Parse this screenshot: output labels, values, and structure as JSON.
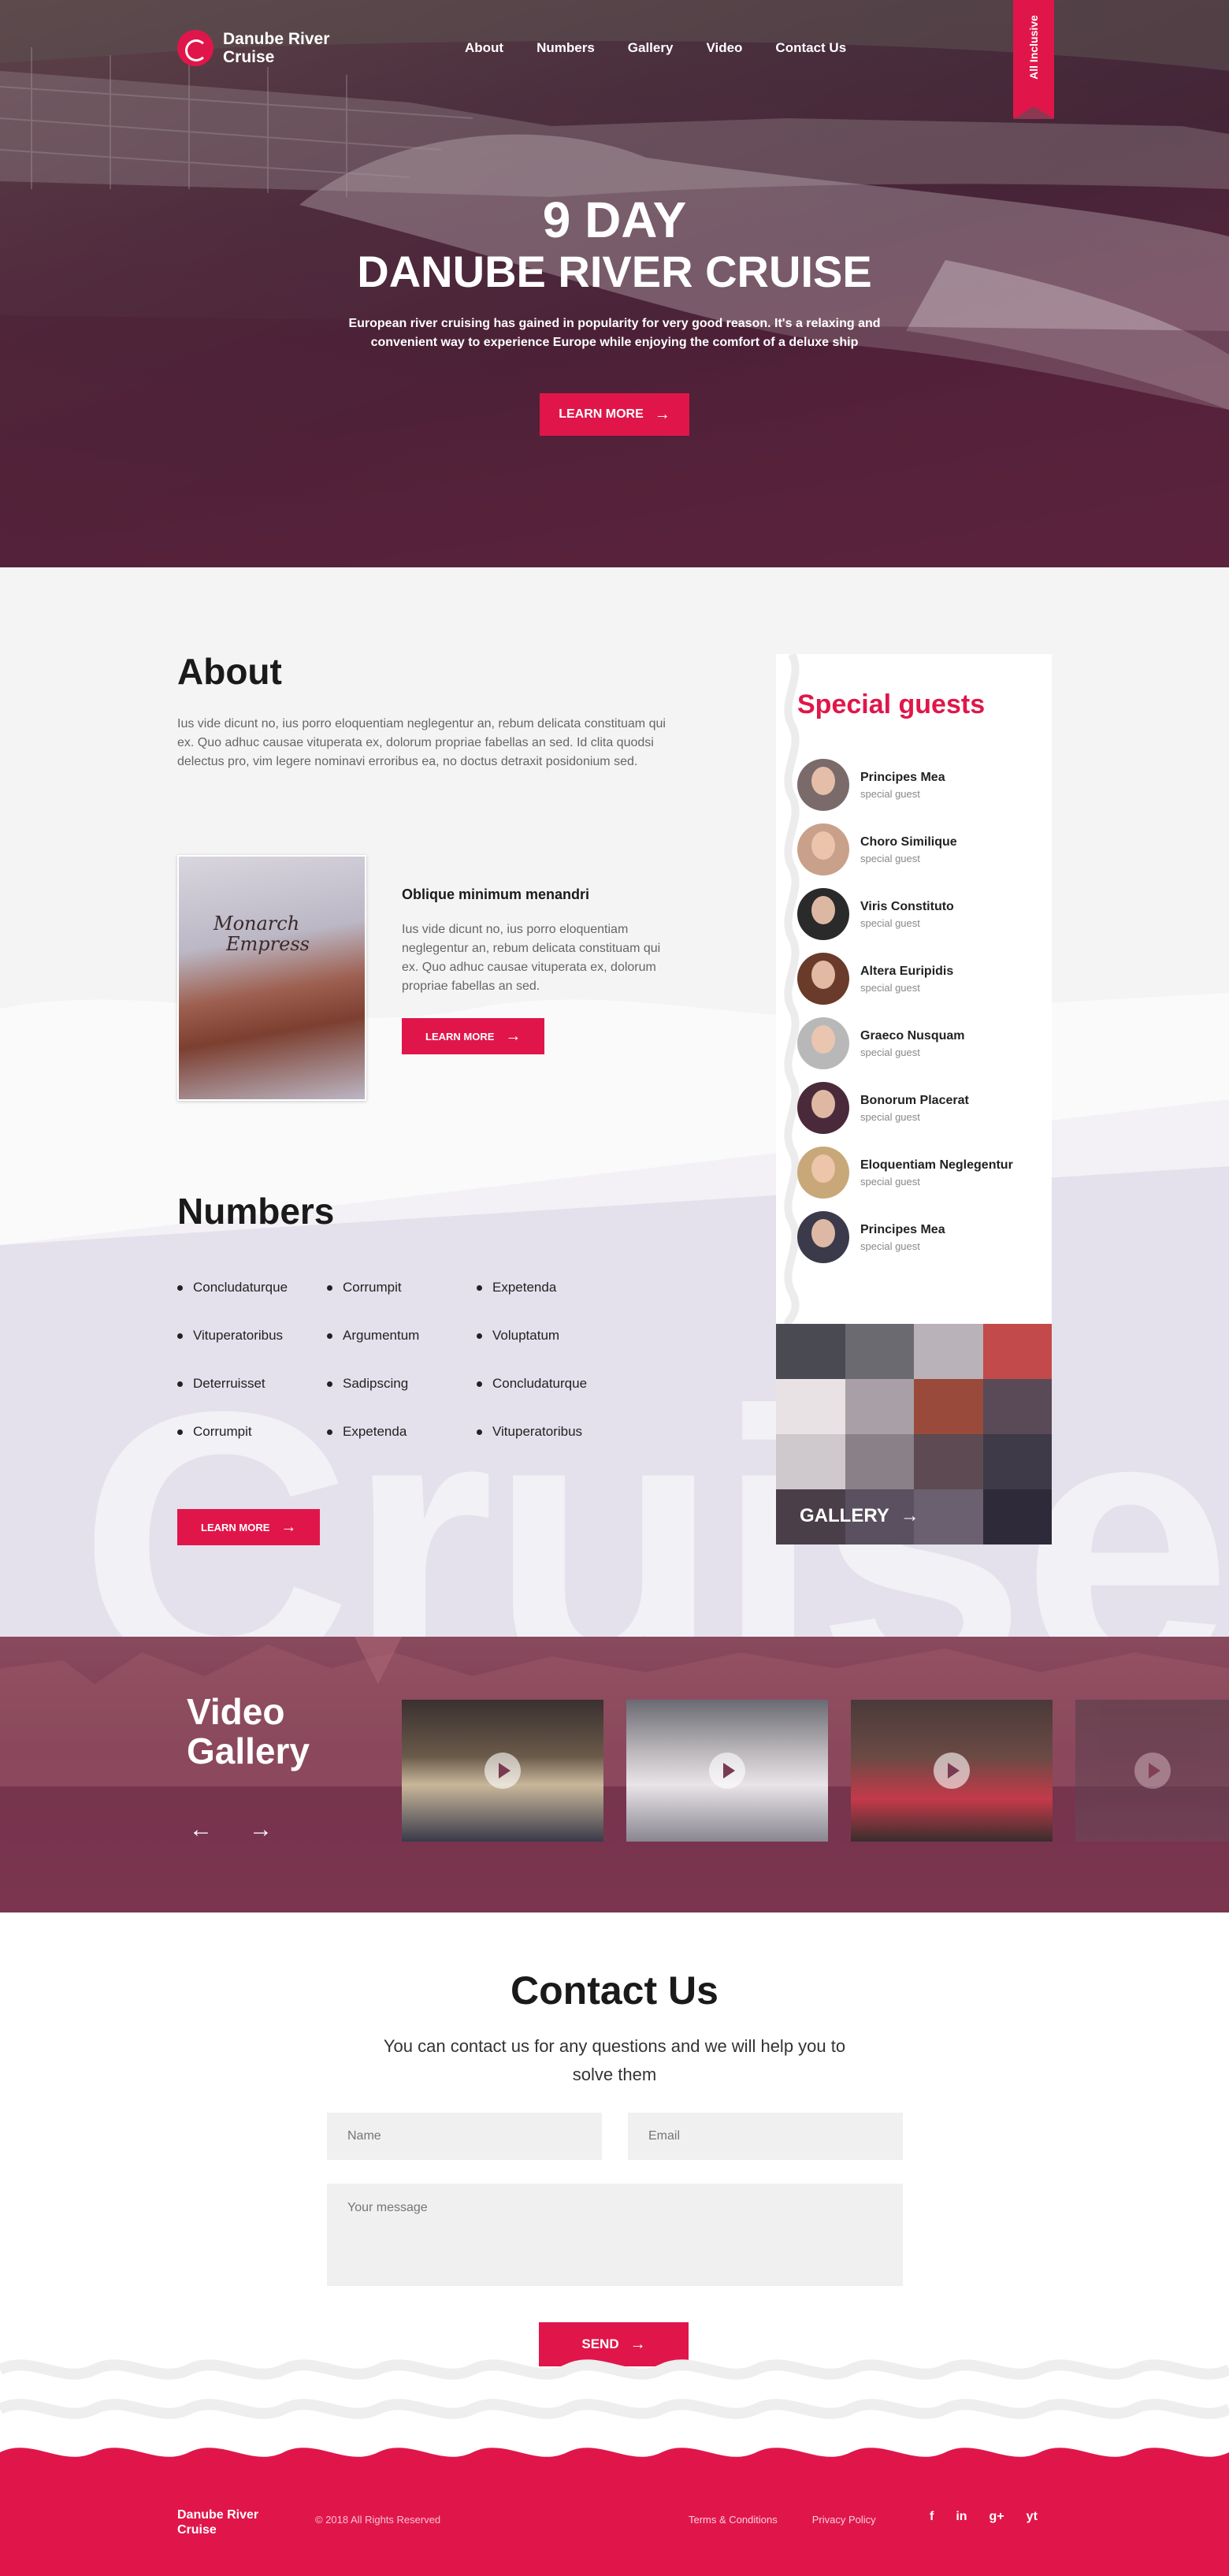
{
  "brand": {
    "name": "Danube River Cruise",
    "line1": "Danube River",
    "line2": "Cruise"
  },
  "nav": {
    "items": [
      {
        "label": "About"
      },
      {
        "label": "Numbers"
      },
      {
        "label": "Gallery"
      },
      {
        "label": "Video"
      },
      {
        "label": "Contact Us"
      }
    ]
  },
  "ribbon": "All Inclusive",
  "hero": {
    "line1": "9 DAY",
    "line2": "DANUBE RIVER CRUISE",
    "subtitle": "European river cruising has gained in popularity for very good reason. It's a relaxing and convenient way to experience Europe while enjoying the comfort of a deluxe ship",
    "button": "LEARN MORE"
  },
  "about": {
    "title": "About",
    "text": "Ius vide dicunt no, ius porro eloquentiam neglegentur an, rebum delicata constituam qui ex. Quo adhuc causae vituperata ex, dolorum propriae fabellas an sed. Id clita quodsi delectus pro, vim legere nominavi erroribus ea, no doctus detraxit posidonium sed.",
    "card": {
      "image_text_1": "Monarch",
      "image_text_2": "Empress",
      "title": "Oblique minimum menandri",
      "text": "Ius vide dicunt no, ius porro eloquentiam neglegentur an, rebum delicata constituam qui ex. Quo adhuc causae vituperata ex, dolorum propriae fabellas an sed.",
      "button": "LEARN MORE"
    }
  },
  "numbers": {
    "title": "Numbers",
    "items": [
      "Concludaturque",
      "Corrumpit",
      "Expetenda",
      "Vituperatoribus",
      "Argumentum",
      "Voluptatum",
      "Deterruisset",
      "Sadipscing",
      "Concludaturque",
      "Corrumpit",
      "Expetenda",
      "Vituperatoribus"
    ],
    "button": "LEARN MORE",
    "watermark": "Cruise"
  },
  "guests": {
    "title": "Special guests",
    "items": [
      {
        "name": "Principes Mea",
        "role": "special guest",
        "color": "#7a6a6a"
      },
      {
        "name": "Choro Similique",
        "role": "special guest",
        "color": "#c9a08a"
      },
      {
        "name": "Viris Constituto",
        "role": "special guest",
        "color": "#2a2a2a"
      },
      {
        "name": "Altera Euripidis",
        "role": "special guest",
        "color": "#6a3a2a"
      },
      {
        "name": "Graeco Nusquam",
        "role": "special guest",
        "color": "#b8b8b8"
      },
      {
        "name": "Bonorum Placerat",
        "role": "special guest",
        "color": "#4a2a3a"
      },
      {
        "name": "Eloquentiam Neglegentur",
        "role": "special guest",
        "color": "#c8a878"
      },
      {
        "name": "Principes Mea",
        "role": "special guest",
        "color": "#3a3a4a"
      }
    ]
  },
  "gallery": {
    "label": "GALLERY"
  },
  "video": {
    "title": "Video Gallery"
  },
  "contact": {
    "title": "Contact Us",
    "subtitle": "You can contact us for any questions and we will help you to solve them",
    "name_placeholder": "Name",
    "email_placeholder": "Email",
    "message_placeholder": "Your message",
    "button": "SEND"
  },
  "footer": {
    "line1": "Danube River",
    "line2": "Cruise",
    "copyright": "© 2018 All Rights Reserved",
    "links": [
      "Terms & Conditions",
      "Privacy Policy"
    ],
    "social": [
      "f",
      "in",
      "g+",
      "yt"
    ]
  },
  "colors": {
    "accent": "#e0164a",
    "hero_overlay": "#5a2c40",
    "numbers_band": "#e4e1ec"
  }
}
